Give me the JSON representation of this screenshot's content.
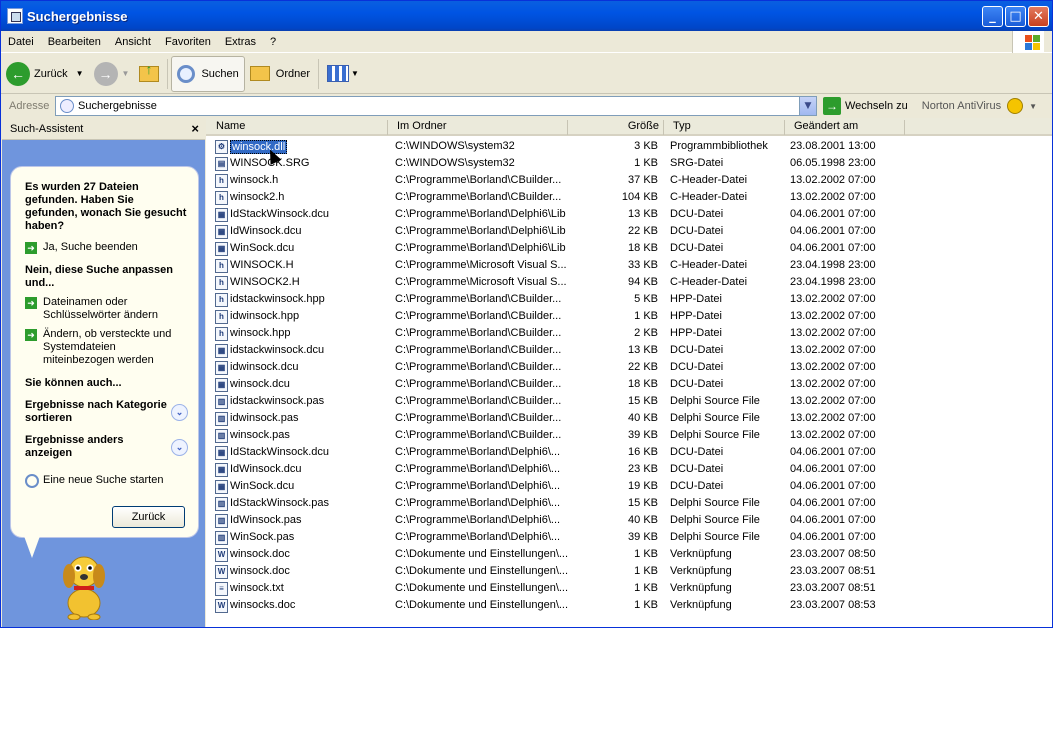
{
  "window": {
    "title": "Suchergebnisse"
  },
  "menu": [
    "Datei",
    "Bearbeiten",
    "Ansicht",
    "Favoriten",
    "Extras",
    "?"
  ],
  "toolbar": {
    "back": "Zurück",
    "search": "Suchen",
    "folders": "Ordner"
  },
  "address": {
    "label": "Adresse",
    "value": "Suchergebnisse",
    "go": "Wechseln zu",
    "norton": "Norton AntiVirus"
  },
  "assistant": {
    "title": "Such-Assistent",
    "close": "×",
    "question": "Es wurden 27 Dateien gefunden. Haben Sie gefunden, wonach Sie gesucht haben?",
    "yes": "Ja, Suche beenden",
    "no_heading": "Nein, diese Suche anpassen und...",
    "opt1": "Dateinamen oder Schlüsselwörter ändern",
    "opt2": "Ändern, ob versteckte und Systemdateien miteinbezogen werden",
    "also": "Sie können auch...",
    "sort": "Ergebnisse nach Kategorie sortieren",
    "view": "Ergebnisse anders anzeigen",
    "newsearch": "Eine neue Suche starten",
    "back": "Zurück"
  },
  "columns": {
    "name": "Name",
    "folder": "Im Ordner",
    "size": "Größe",
    "type": "Typ",
    "changed": "Geändert am"
  },
  "files": [
    {
      "name": "winsock.dll",
      "folder": "C:\\WINDOWS\\system32",
      "size": "3 KB",
      "type": "Programmbibliothek",
      "date": "23.08.2001 13:00",
      "icon": "dll"
    },
    {
      "name": "WINSOCK.SRG",
      "folder": "C:\\WINDOWS\\system32",
      "size": "1 KB",
      "type": "SRG-Datei",
      "date": "06.05.1998 23:00",
      "icon": "file"
    },
    {
      "name": "winsock.h",
      "folder": "C:\\Programme\\Borland\\CBuilder...",
      "size": "37 KB",
      "type": "C-Header-Datei",
      "date": "13.02.2002 07:00",
      "icon": "h"
    },
    {
      "name": "winsock2.h",
      "folder": "C:\\Programme\\Borland\\CBuilder...",
      "size": "104 KB",
      "type": "C-Header-Datei",
      "date": "13.02.2002 07:00",
      "icon": "h"
    },
    {
      "name": "IdStackWinsock.dcu",
      "folder": "C:\\Programme\\Borland\\Delphi6\\Lib",
      "size": "13 KB",
      "type": "DCU-Datei",
      "date": "04.06.2001 07:00",
      "icon": "dcu"
    },
    {
      "name": "IdWinsock.dcu",
      "folder": "C:\\Programme\\Borland\\Delphi6\\Lib",
      "size": "22 KB",
      "type": "DCU-Datei",
      "date": "04.06.2001 07:00",
      "icon": "dcu"
    },
    {
      "name": "WinSock.dcu",
      "folder": "C:\\Programme\\Borland\\Delphi6\\Lib",
      "size": "18 KB",
      "type": "DCU-Datei",
      "date": "04.06.2001 07:00",
      "icon": "dcu"
    },
    {
      "name": "WINSOCK.H",
      "folder": "C:\\Programme\\Microsoft Visual S...",
      "size": "33 KB",
      "type": "C-Header-Datei",
      "date": "23.04.1998 23:00",
      "icon": "h"
    },
    {
      "name": "WINSOCK2.H",
      "folder": "C:\\Programme\\Microsoft Visual S...",
      "size": "94 KB",
      "type": "C-Header-Datei",
      "date": "23.04.1998 23:00",
      "icon": "h"
    },
    {
      "name": "idstackwinsock.hpp",
      "folder": "C:\\Programme\\Borland\\CBuilder...",
      "size": "5 KB",
      "type": "HPP-Datei",
      "date": "13.02.2002 07:00",
      "icon": "h"
    },
    {
      "name": "idwinsock.hpp",
      "folder": "C:\\Programme\\Borland\\CBuilder...",
      "size": "1 KB",
      "type": "HPP-Datei",
      "date": "13.02.2002 07:00",
      "icon": "h"
    },
    {
      "name": "winsock.hpp",
      "folder": "C:\\Programme\\Borland\\CBuilder...",
      "size": "2 KB",
      "type": "HPP-Datei",
      "date": "13.02.2002 07:00",
      "icon": "h"
    },
    {
      "name": "idstackwinsock.dcu",
      "folder": "C:\\Programme\\Borland\\CBuilder...",
      "size": "13 KB",
      "type": "DCU-Datei",
      "date": "13.02.2002 07:00",
      "icon": "dcu"
    },
    {
      "name": "idwinsock.dcu",
      "folder": "C:\\Programme\\Borland\\CBuilder...",
      "size": "22 KB",
      "type": "DCU-Datei",
      "date": "13.02.2002 07:00",
      "icon": "dcu"
    },
    {
      "name": "winsock.dcu",
      "folder": "C:\\Programme\\Borland\\CBuilder...",
      "size": "18 KB",
      "type": "DCU-Datei",
      "date": "13.02.2002 07:00",
      "icon": "dcu"
    },
    {
      "name": "idstackwinsock.pas",
      "folder": "C:\\Programme\\Borland\\CBuilder...",
      "size": "15 KB",
      "type": "Delphi Source File",
      "date": "13.02.2002 07:00",
      "icon": "pas"
    },
    {
      "name": "idwinsock.pas",
      "folder": "C:\\Programme\\Borland\\CBuilder...",
      "size": "40 KB",
      "type": "Delphi Source File",
      "date": "13.02.2002 07:00",
      "icon": "pas"
    },
    {
      "name": "winsock.pas",
      "folder": "C:\\Programme\\Borland\\CBuilder...",
      "size": "39 KB",
      "type": "Delphi Source File",
      "date": "13.02.2002 07:00",
      "icon": "pas"
    },
    {
      "name": "IdStackWinsock.dcu",
      "folder": "C:\\Programme\\Borland\\Delphi6\\...",
      "size": "16 KB",
      "type": "DCU-Datei",
      "date": "04.06.2001 07:00",
      "icon": "dcu"
    },
    {
      "name": "IdWinsock.dcu",
      "folder": "C:\\Programme\\Borland\\Delphi6\\...",
      "size": "23 KB",
      "type": "DCU-Datei",
      "date": "04.06.2001 07:00",
      "icon": "dcu"
    },
    {
      "name": "WinSock.dcu",
      "folder": "C:\\Programme\\Borland\\Delphi6\\...",
      "size": "19 KB",
      "type": "DCU-Datei",
      "date": "04.06.2001 07:00",
      "icon": "dcu"
    },
    {
      "name": "IdStackWinsock.pas",
      "folder": "C:\\Programme\\Borland\\Delphi6\\...",
      "size": "15 KB",
      "type": "Delphi Source File",
      "date": "04.06.2001 07:00",
      "icon": "pas"
    },
    {
      "name": "IdWinsock.pas",
      "folder": "C:\\Programme\\Borland\\Delphi6\\...",
      "size": "40 KB",
      "type": "Delphi Source File",
      "date": "04.06.2001 07:00",
      "icon": "pas"
    },
    {
      "name": "WinSock.pas",
      "folder": "C:\\Programme\\Borland\\Delphi6\\...",
      "size": "39 KB",
      "type": "Delphi Source File",
      "date": "04.06.2001 07:00",
      "icon": "pas"
    },
    {
      "name": "winsock.doc",
      "folder": "C:\\Dokumente und Einstellungen\\...",
      "size": "1 KB",
      "type": "Verknüpfung",
      "date": "23.03.2007 08:50",
      "icon": "doc"
    },
    {
      "name": "winsock.doc",
      "folder": "C:\\Dokumente und Einstellungen\\...",
      "size": "1 KB",
      "type": "Verknüpfung",
      "date": "23.03.2007 08:51",
      "icon": "doc"
    },
    {
      "name": "winsock.txt",
      "folder": "C:\\Dokumente und Einstellungen\\...",
      "size": "1 KB",
      "type": "Verknüpfung",
      "date": "23.03.2007 08:51",
      "icon": "txt"
    },
    {
      "name": "winsocks.doc",
      "folder": "C:\\Dokumente und Einstellungen\\...",
      "size": "1 KB",
      "type": "Verknüpfung",
      "date": "23.03.2007 08:53",
      "icon": "doc"
    }
  ]
}
